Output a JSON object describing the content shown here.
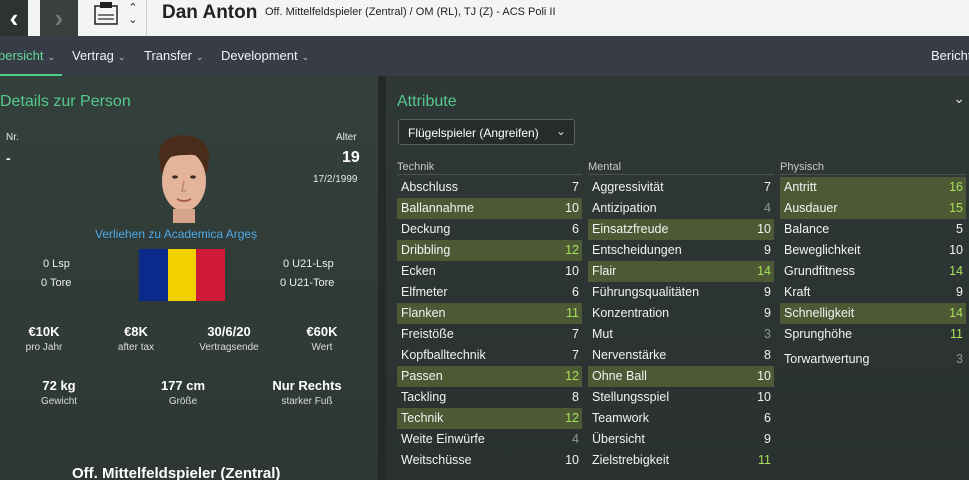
{
  "header": {
    "back_icon": "chevron-left-icon",
    "forward_icon": "chevron-right-icon",
    "name": "Dan Anton",
    "position_line": "Off. Mittelfeldspieler (Zentral) / OM (RL), TJ (Z) - ACS Poli II"
  },
  "tabs": [
    {
      "label": "bersicht",
      "active": true
    },
    {
      "label": "Vertrag",
      "active": false
    },
    {
      "label": "Transfer",
      "active": false
    },
    {
      "label": "Development",
      "active": false
    },
    {
      "label": "Bericht",
      "active": false
    }
  ],
  "details": {
    "title": "Details zur Person",
    "nr_label": "Nr.",
    "nr_value": "-",
    "age_label": "Alter",
    "age_value": "19",
    "birth_date": "17/2/1999",
    "loan_text": "Verliehen zu Academica Argeș",
    "lsp": "0 Lsp",
    "tore": "0 Tore",
    "u21_lsp": "0 U21-Lsp",
    "u21_tore": "0 U21-Tore",
    "flag_colors": [
      "#0b2a8c",
      "#f2d000",
      "#cf1a37"
    ],
    "money": [
      {
        "value": "€10K",
        "label": "pro Jahr"
      },
      {
        "value": "€8K",
        "label": "after tax"
      },
      {
        "value": "30/6/20",
        "label": "Vertragsende"
      },
      {
        "value": "€60K",
        "label": "Wert"
      }
    ],
    "physical": [
      {
        "value": "72 kg",
        "label": "Gewicht"
      },
      {
        "value": "177 cm",
        "label": "Größe"
      },
      {
        "value": "Nur Rechts",
        "label": "starker Fuß"
      }
    ],
    "position_title": "Off. Mittelfeldspieler (Zentral)"
  },
  "attributes": {
    "title": "Attribute",
    "role_select": "Flügelspieler (Angreifen)",
    "highlight_color": "#4d5934",
    "columns": [
      {
        "heading": "Technik",
        "items": [
          {
            "name": "Abschluss",
            "value": "7",
            "hl": false
          },
          {
            "name": "Ballannahme",
            "value": "10",
            "hl": true
          },
          {
            "name": "Deckung",
            "value": "6",
            "hl": false
          },
          {
            "name": "Dribbling",
            "value": "12",
            "hl": true
          },
          {
            "name": "Ecken",
            "value": "10",
            "hl": false
          },
          {
            "name": "Elfmeter",
            "value": "6",
            "hl": false
          },
          {
            "name": "Flanken",
            "value": "11",
            "hl": true
          },
          {
            "name": "Freistöße",
            "value": "7",
            "hl": false
          },
          {
            "name": "Kopfballtechnik",
            "value": "7",
            "hl": false
          },
          {
            "name": "Passen",
            "value": "12",
            "hl": true
          },
          {
            "name": "Tackling",
            "value": "8",
            "hl": false
          },
          {
            "name": "Technik",
            "value": "12",
            "hl": true
          },
          {
            "name": "Weite Einwürfe",
            "value": "4",
            "hl": false
          },
          {
            "name": "Weitschüsse",
            "value": "10",
            "hl": false
          }
        ]
      },
      {
        "heading": "Mental",
        "items": [
          {
            "name": "Aggressivität",
            "value": "7",
            "hl": false
          },
          {
            "name": "Antizipation",
            "value": "4",
            "hl": false
          },
          {
            "name": "Einsatzfreude",
            "value": "10",
            "hl": true
          },
          {
            "name": "Entscheidungen",
            "value": "9",
            "hl": false
          },
          {
            "name": "Flair",
            "value": "14",
            "hl": true
          },
          {
            "name": "Führungsqualitäten",
            "value": "9",
            "hl": false
          },
          {
            "name": "Konzentration",
            "value": "9",
            "hl": false
          },
          {
            "name": "Mut",
            "value": "3",
            "hl": false
          },
          {
            "name": "Nervenstärke",
            "value": "8",
            "hl": false
          },
          {
            "name": "Ohne Ball",
            "value": "10",
            "hl": true
          },
          {
            "name": "Stellungsspiel",
            "value": "10",
            "hl": false
          },
          {
            "name": "Teamwork",
            "value": "6",
            "hl": false
          },
          {
            "name": "Übersicht",
            "value": "9",
            "hl": false
          },
          {
            "name": "Zielstrebigkeit",
            "value": "11",
            "hl": false
          }
        ]
      },
      {
        "heading": "Physisch",
        "items": [
          {
            "name": "Antritt",
            "value": "16",
            "hl": true
          },
          {
            "name": "Ausdauer",
            "value": "15",
            "hl": true
          },
          {
            "name": "Balance",
            "value": "5",
            "hl": false
          },
          {
            "name": "Beweglichkeit",
            "value": "10",
            "hl": false
          },
          {
            "name": "Grundfitness",
            "value": "14",
            "hl": false
          },
          {
            "name": "Kraft",
            "value": "9",
            "hl": false
          },
          {
            "name": "Schnelligkeit",
            "value": "14",
            "hl": true
          },
          {
            "name": "Sprunghöhe",
            "value": "11",
            "hl": false
          },
          {
            "name": "Torwartwertung",
            "value": "3",
            "hl": false
          }
        ]
      }
    ]
  }
}
